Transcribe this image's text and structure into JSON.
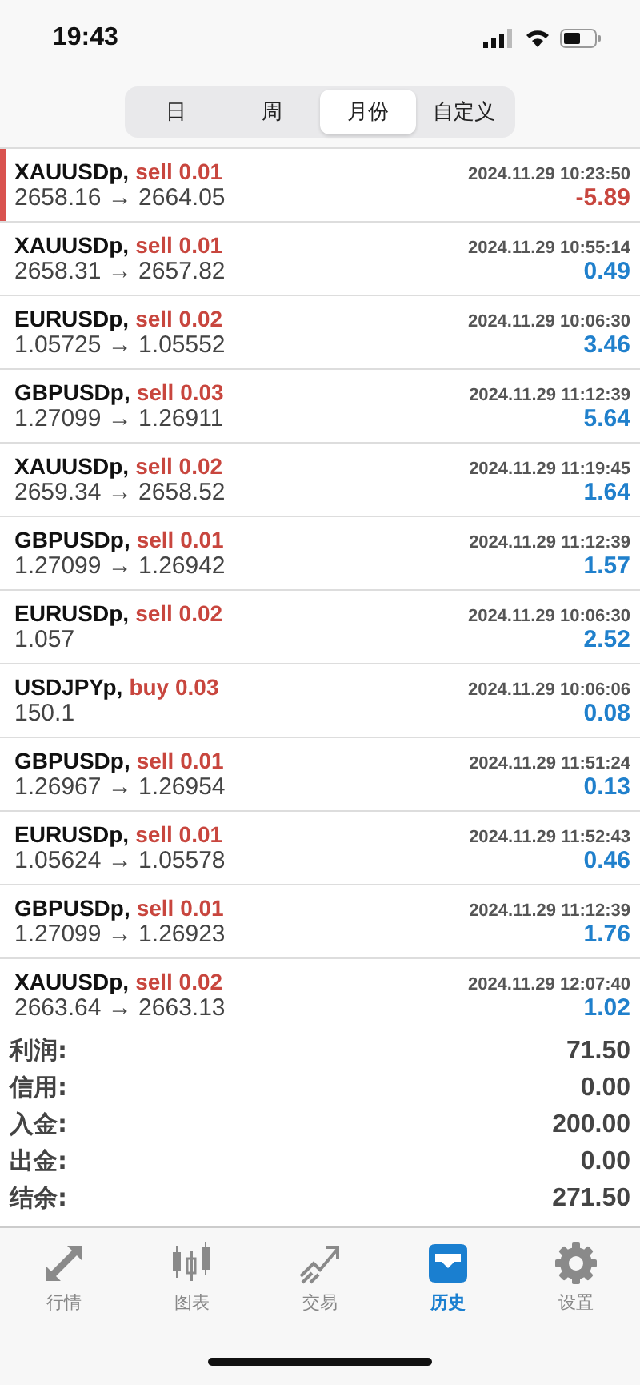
{
  "status_bar": {
    "time": "19:43"
  },
  "period_tabs": [
    {
      "label": "日",
      "selected": false
    },
    {
      "label": "周",
      "selected": false
    },
    {
      "label": "月份",
      "selected": true
    },
    {
      "label": "自定义",
      "selected": false
    }
  ],
  "trades": [
    {
      "symbol": "XAUUSDp,",
      "trade": "sell 0.01",
      "time": "2024.11.29 10:23:50",
      "prices": "2658.16 → 2664.05",
      "profit": "-5.89",
      "loss": true,
      "selected": true
    },
    {
      "symbol": "XAUUSDp,",
      "trade": "sell 0.01",
      "time": "2024.11.29 10:55:14",
      "prices": "2658.31 → 2657.82",
      "profit": "0.49",
      "loss": false,
      "selected": false
    },
    {
      "symbol": "EURUSDp,",
      "trade": "sell 0.02",
      "time": "2024.11.29 10:06:30",
      "prices": "1.05725 → 1.05552",
      "profit": "3.46",
      "loss": false,
      "selected": false
    },
    {
      "symbol": "GBPUSDp,",
      "trade": "sell 0.03",
      "time": "2024.11.29 11:12:39",
      "prices": "1.27099 → 1.26911",
      "profit": "5.64",
      "loss": false,
      "selected": false
    },
    {
      "symbol": "XAUUSDp,",
      "trade": "sell 0.02",
      "time": "2024.11.29 11:19:45",
      "prices": "2659.34 → 2658.52",
      "profit": "1.64",
      "loss": false,
      "selected": false
    },
    {
      "symbol": "GBPUSDp,",
      "trade": "sell 0.01",
      "time": "2024.11.29 11:12:39",
      "prices": "1.27099 → 1.26942",
      "profit": "1.57",
      "loss": false,
      "selected": false
    },
    {
      "symbol": "EURUSDp,",
      "trade": "sell 0.02",
      "time": "2024.11.29 10:06:30",
      "prices": "1.057",
      "profit": "2.52",
      "loss": false,
      "selected": false
    },
    {
      "symbol": "USDJPYp,",
      "trade": "buy 0.03",
      "time": "2024.11.29 10:06:06",
      "prices": "150.1",
      "profit": "0.08",
      "loss": false,
      "selected": false
    },
    {
      "symbol": "GBPUSDp,",
      "trade": "sell 0.01",
      "time": "2024.11.29 11:51:24",
      "prices": "1.26967 → 1.26954",
      "profit": "0.13",
      "loss": false,
      "selected": false
    },
    {
      "symbol": "EURUSDp,",
      "trade": "sell 0.01",
      "time": "2024.11.29 11:52:43",
      "prices": "1.05624 → 1.05578",
      "profit": "0.46",
      "loss": false,
      "selected": false
    },
    {
      "symbol": "GBPUSDp,",
      "trade": "sell 0.01",
      "time": "2024.11.29 11:12:39",
      "prices": "1.27099 → 1.26923",
      "profit": "1.76",
      "loss": false,
      "selected": false
    },
    {
      "symbol": "XAUUSDp,",
      "trade": "sell 0.02",
      "time": "2024.11.29 12:07:40",
      "prices": "2663.64 → 2663.13",
      "profit": "1.02",
      "loss": false,
      "selected": false
    }
  ],
  "summary": [
    {
      "label": "利润:",
      "value": "71.50"
    },
    {
      "label": "信用:",
      "value": "0.00"
    },
    {
      "label": "入金:",
      "value": "200.00"
    },
    {
      "label": "出金:",
      "value": "0.00"
    },
    {
      "label": "结余:",
      "value": "271.50"
    }
  ],
  "tab_bar": [
    {
      "kind": "quotes",
      "label": "行情",
      "selected": false
    },
    {
      "kind": "chart",
      "label": "图表",
      "selected": false
    },
    {
      "kind": "trade",
      "label": "交易",
      "selected": false
    },
    {
      "kind": "history",
      "label": "历史",
      "selected": true
    },
    {
      "kind": "settings",
      "label": "设置",
      "selected": false
    }
  ]
}
